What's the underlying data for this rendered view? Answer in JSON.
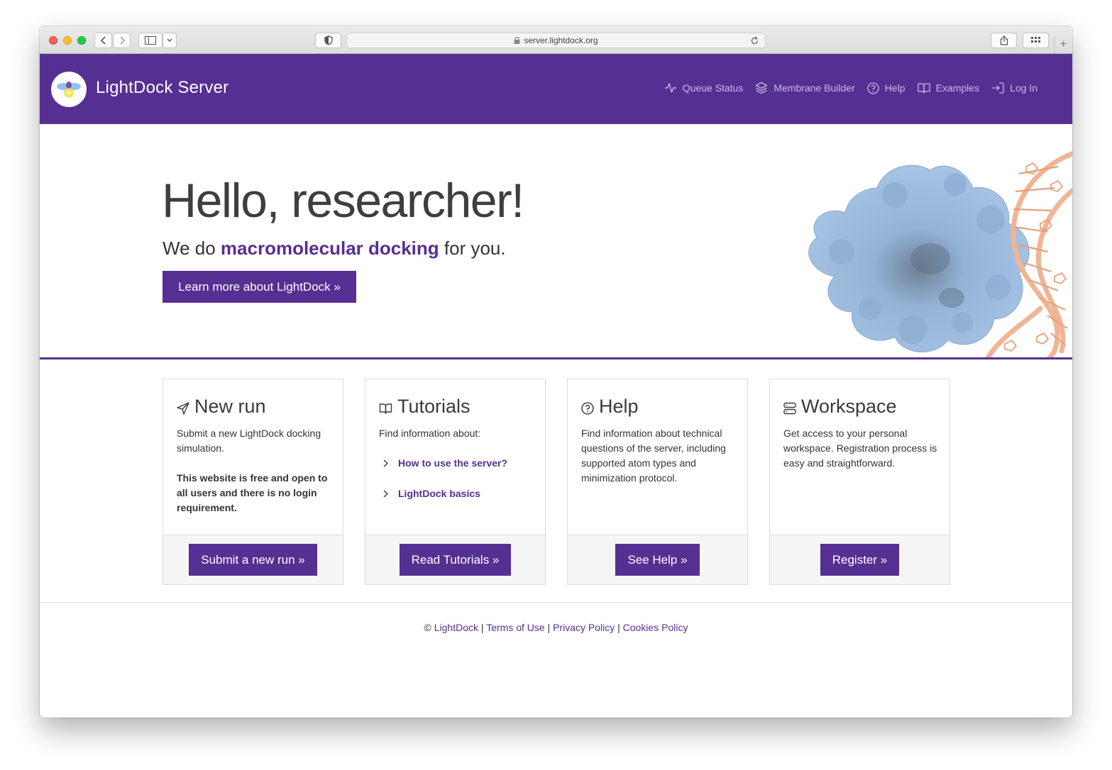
{
  "browser": {
    "url": "server.lightdock.org"
  },
  "navbar": {
    "brand": "LightDock Server",
    "links": [
      {
        "label": "Queue Status",
        "icon": "activity-icon"
      },
      {
        "label": "Membrane Builder",
        "icon": "layers-icon"
      },
      {
        "label": "Help",
        "icon": "help-circle-icon"
      },
      {
        "label": "Examples",
        "icon": "book-open-icon"
      },
      {
        "label": "Log In",
        "icon": "log-in-icon"
      }
    ]
  },
  "hero": {
    "title": "Hello, researcher!",
    "subtitle_pre": "We do ",
    "subtitle_highlight": "macromolecular docking",
    "subtitle_post": " for you.",
    "button": "Learn more about LightDock »"
  },
  "cards": {
    "new_run": {
      "title": "New run",
      "text": "Submit a new LightDock docking simulation.",
      "bold_text": "This website is free and open to all users and there is no login requirement.",
      "button": "Submit a new run »"
    },
    "tutorials": {
      "title": "Tutorials",
      "text": "Find information about:",
      "links": [
        "How to use the server?",
        "LightDock basics"
      ],
      "button": "Read Tutorials »"
    },
    "help": {
      "title": "Help",
      "text": "Find information about technical questions of the server, including supported atom types and minimization protocol.",
      "button": "See Help »"
    },
    "workspace": {
      "title": "Workspace",
      "text": "Get access to your personal workspace. Registration process is easy and straightforward.",
      "button": "Register »"
    }
  },
  "footer": {
    "copyright": "© ",
    "links": [
      "LightDock",
      "Terms of Use",
      "Privacy Policy",
      "Cookies Policy"
    ],
    "separator": " | "
  },
  "colors": {
    "brand_purple": "#562f93",
    "nav_link": "#c9b9e2",
    "protein": "#9cbce0",
    "dna": "#f0b594"
  }
}
